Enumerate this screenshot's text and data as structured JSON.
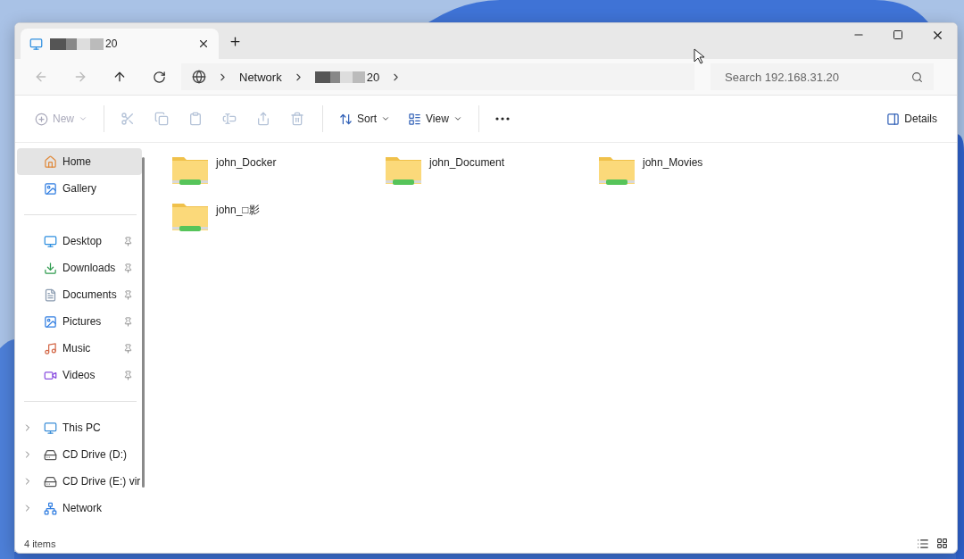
{
  "window": {
    "tab": {
      "title": "20",
      "redacted": true,
      "selected": true
    }
  },
  "address": {
    "crumbs": [
      {
        "label": "Network",
        "redacted": false
      },
      {
        "label": "20",
        "redacted": true
      }
    ],
    "search": {
      "placeholder": "Search 192.168.31.20"
    }
  },
  "toolbar": [
    {
      "kind": "menu",
      "label": "New",
      "disabled": true
    },
    {
      "kind": "icon",
      "disabled": true
    },
    {
      "kind": "icon",
      "disabled": true
    },
    {
      "kind": "icon",
      "disabled": true
    },
    {
      "kind": "icon",
      "disabled": true
    },
    {
      "kind": "icon",
      "disabled": true
    },
    {
      "kind": "icon",
      "disabled": true
    },
    {
      "kind": "menu",
      "label": "Sort",
      "disabled": false
    },
    {
      "kind": "menu",
      "label": "View",
      "disabled": false
    },
    {
      "kind": "more",
      "disabled": false
    }
  ],
  "details_button": {
    "label": "Details"
  },
  "sidebar": {
    "sections": [
      {
        "items": [
          {
            "label": "Home",
            "selected": true
          },
          {
            "label": "Gallery",
            "selected": false
          }
        ]
      },
      {
        "items": [
          {
            "label": "Desktop",
            "selected": false,
            "pinned": true
          },
          {
            "label": "Downloads",
            "selected": false,
            "pinned": true
          },
          {
            "label": "Documents",
            "selected": false,
            "pinned": true
          },
          {
            "label": "Pictures",
            "selected": false,
            "pinned": true
          },
          {
            "label": "Music",
            "selected": false,
            "pinned": true
          },
          {
            "label": "Videos",
            "selected": false,
            "pinned": true
          }
        ]
      },
      {
        "items": [
          {
            "label": "This PC",
            "selected": false,
            "expanded": false
          },
          {
            "label": "CD Drive (D:)",
            "selected": false,
            "expanded": false
          },
          {
            "label": "CD Drive (E:) vir",
            "selected": false,
            "expanded": false
          },
          {
            "label": "Network",
            "selected": false,
            "expanded": false
          }
        ]
      }
    ]
  },
  "files": [
    {
      "name": "john_Docker"
    },
    {
      "name": "john_Document"
    },
    {
      "name": "john_Movies"
    },
    {
      "name": "john_□影"
    }
  ],
  "status_bar": {
    "count": "4 items"
  }
}
